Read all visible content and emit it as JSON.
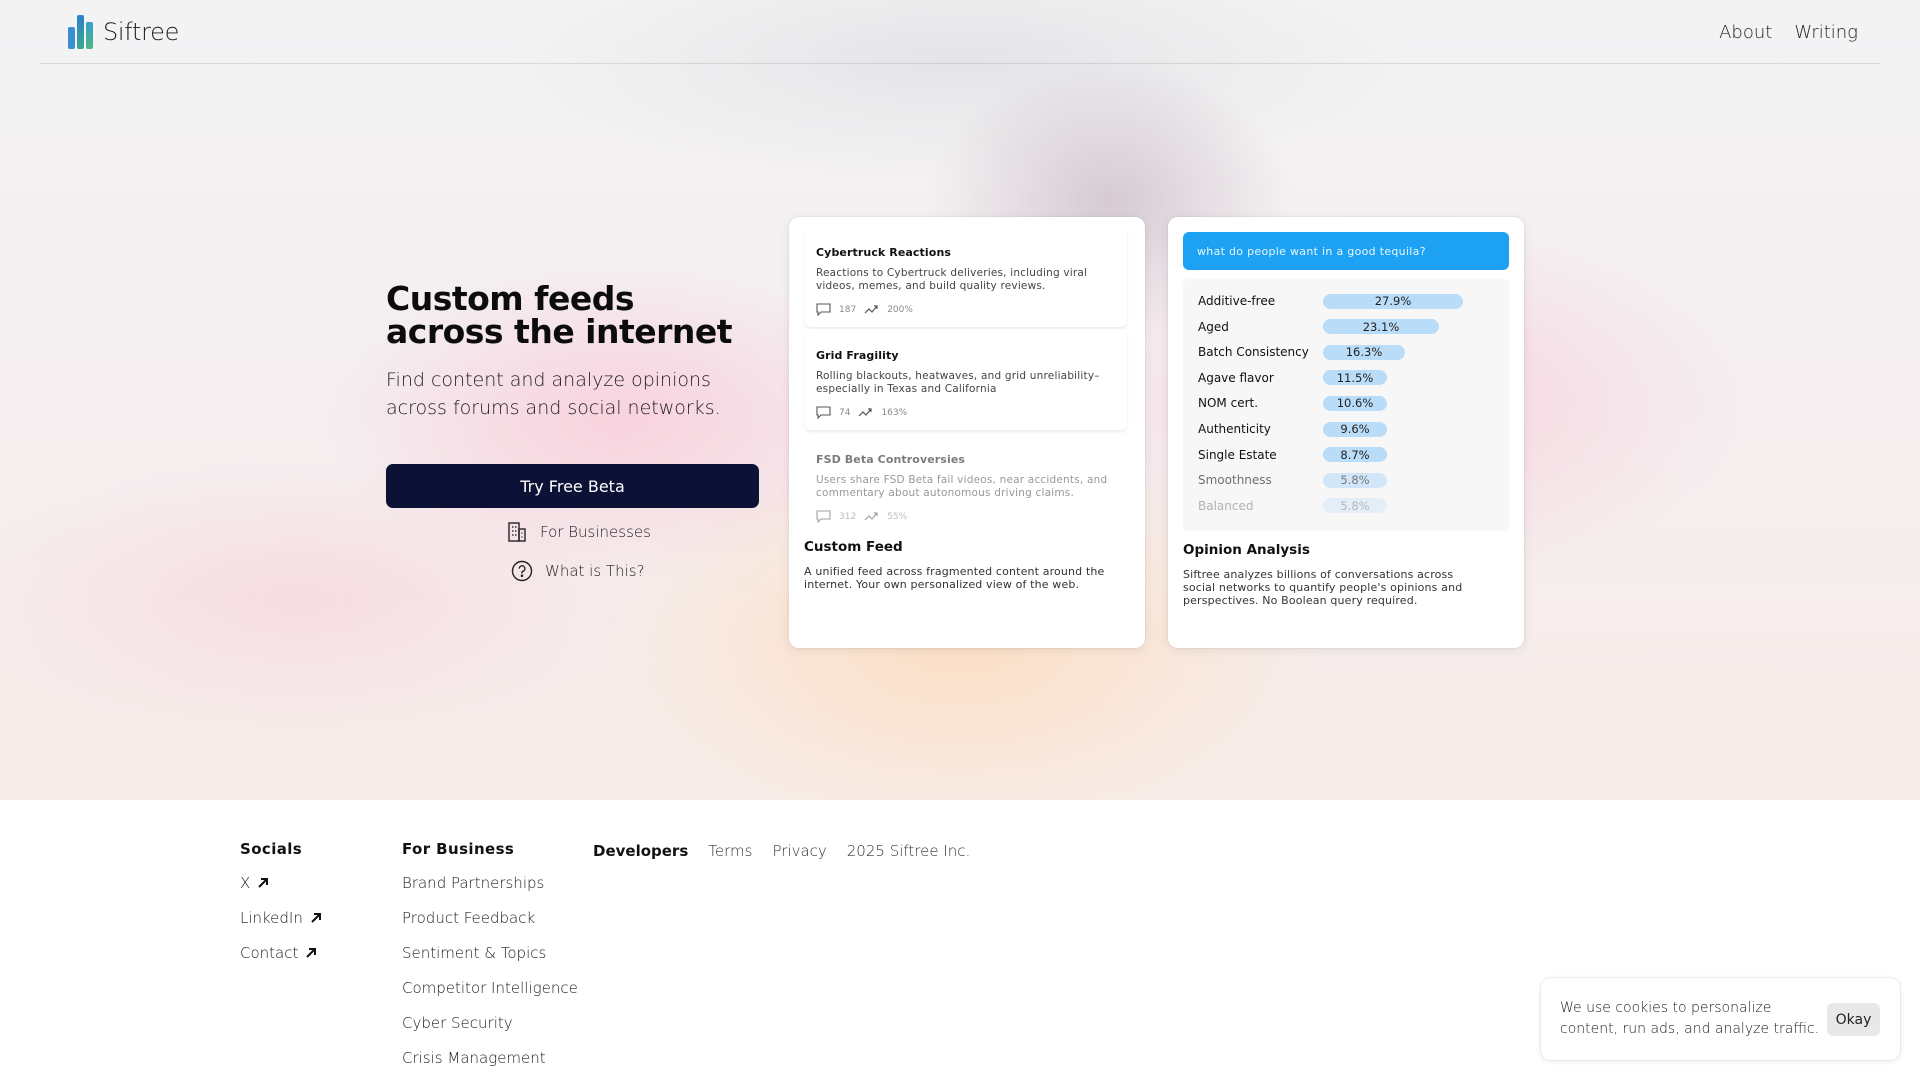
{
  "brand": {
    "name": "Siftree"
  },
  "nav": {
    "about": "About",
    "writing": "Writing"
  },
  "hero": {
    "title": "Custom feeds across the internet",
    "subtitle": "Find content and analyze opinions across forums and social networks.",
    "cta": "Try Free Beta",
    "for_businesses": "For Businesses",
    "what_is_this": "What is This?"
  },
  "feed_card": {
    "items": [
      {
        "title": "Cybertruck Reactions",
        "desc": "Reactions to Cybertruck deliveries, including viral videos, memes, and build quality reviews.",
        "comments": "187",
        "trend": "200%"
      },
      {
        "title": "Grid Fragility",
        "desc": "Rolling blackouts, heatwaves, and grid unreliability–especially in Texas and California",
        "comments": "74",
        "trend": "163%"
      },
      {
        "title": "FSD Beta Controversies",
        "desc": "Users share FSD Beta fail videos, near accidents, and commentary about autonomous driving claims.",
        "comments": "312",
        "trend": "55%"
      }
    ],
    "title": "Custom Feed",
    "desc": "A unified feed across fragmented content around the internet. Your own personalized view of the web."
  },
  "opinion_card": {
    "query": "what do people want in a good tequila?",
    "rows": [
      {
        "label": "Additive-free",
        "value": "27.9%",
        "pct": 27.9
      },
      {
        "label": "Aged",
        "value": "23.1%",
        "pct": 23.1
      },
      {
        "label": "Batch Consistency",
        "value": "16.3%",
        "pct": 16.3
      },
      {
        "label": "Agave flavor",
        "value": "11.5%",
        "pct": 11.5
      },
      {
        "label": "NOM cert.",
        "value": "10.6%",
        "pct": 10.6
      },
      {
        "label": "Authenticity",
        "value": "9.6%",
        "pct": 9.6
      },
      {
        "label": "Single Estate",
        "value": "8.7%",
        "pct": 8.7
      },
      {
        "label": "Smoothness",
        "value": "5.8%",
        "pct": 5.8
      },
      {
        "label": "Balanced",
        "value": "5.8%",
        "pct": 5.8
      }
    ],
    "title": "Opinion Analysis",
    "desc": "Siftree analyzes billions of conversations across social networks to quantify people's opinions and perspectives. No Boolean query required."
  },
  "footer": {
    "socials": {
      "heading": "Socials",
      "links": [
        "X",
        "LinkedIn",
        "Contact"
      ]
    },
    "business": {
      "heading": "For Business",
      "links": [
        "Brand Partnerships",
        "Product Feedback",
        "Sentiment & Topics",
        "Competitor Intelligence",
        "Cyber Security",
        "Crisis Management"
      ]
    },
    "developers": "Developers",
    "terms": "Terms",
    "privacy": "Privacy",
    "copyright": "2025 Siftree Inc."
  },
  "cookie": {
    "text": "We use cookies to personalize content, run ads, and analyze traffic.",
    "button": "Okay"
  },
  "colors": {
    "cta": "#0c1136",
    "query_bar": "#1da1f2",
    "bar": "#b9dcf8"
  },
  "icons": [
    "logo-mark-icon",
    "building-icon",
    "question-circle-icon",
    "comment-icon",
    "trend-up-icon",
    "arrow-up-right-icon"
  ]
}
